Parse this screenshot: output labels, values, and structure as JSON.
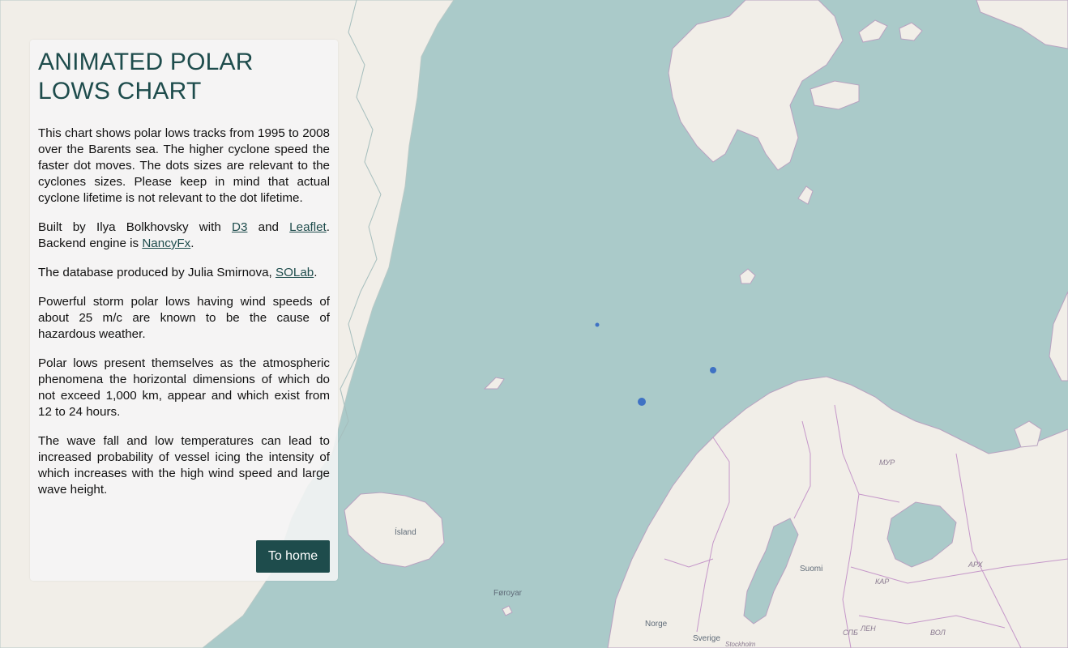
{
  "panel": {
    "title": "ANIMATED POLAR LOWS CHART",
    "p1": "This chart shows polar lows tracks from 1995 to 2008 over the Barents sea. The higher cyclone speed the faster dot moves. The dots sizes are relevant to the cyclones sizes. Please keep in mind that actual cyclone lifetime is not relevant to the dot lifetime.",
    "p2_before": "Built by Ilya Bolkhovsky with ",
    "link_d3": "D3",
    "p2_and": " and ",
    "link_leaflet": "Leaflet",
    "p2_mid": ". Backend engine is ",
    "link_nancy": "NancyFx",
    "p2_end": ".",
    "p3_before": "The database produced by Julia Smirnova, ",
    "link_solab": "SOLab",
    "p3_end": ".",
    "p4": "Powerful storm polar lows having wind speeds of about 25 m/c are known to be the cause of hazardous weather.",
    "p5": "Polar lows present themselves as the atmospheric phenomena the horizontal dimensions of which do not exceed 1,000 km, appear and which exist from 12 to 24 hours.",
    "p6": "The wave fall and low temperatures can lead to increased probability of vessel icing the intensity of which increases with the high wind speed and large wave height.",
    "home_button": "To home"
  },
  "map": {
    "labels": {
      "island": "Ísland",
      "faroe": "Føroyar",
      "finland": "Suomi",
      "norway": "Norge",
      "sweden": "Sverige",
      "stockholm": "Stockholm",
      "murmansk": "МУР",
      "arkhangelsk": "АРХ",
      "karelia": "КАР",
      "spb": "СПБ",
      "len": "ЛЕН",
      "vol": "ВОЛ"
    },
    "colors": {
      "water": "#aacac9",
      "land": "#f1eee8",
      "border": "#c597c9",
      "dots": "#3f72c4"
    }
  }
}
